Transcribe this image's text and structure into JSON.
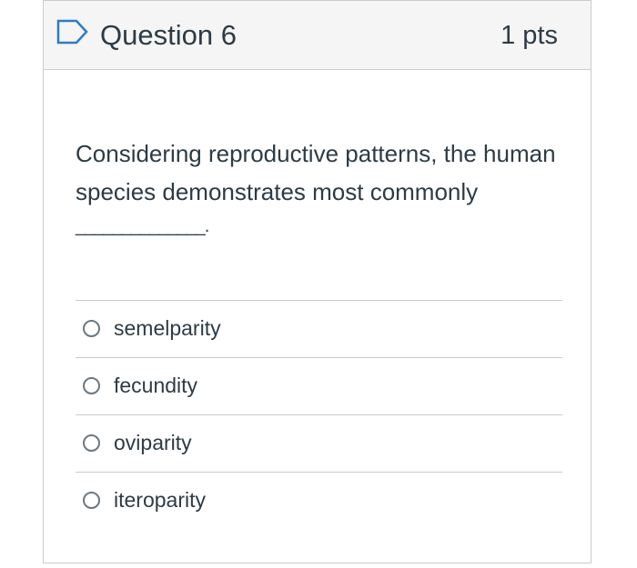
{
  "question": {
    "title": "Question 6",
    "points": "1 pts",
    "text": "Considering reproductive patterns, the human species demonstrates most commonly",
    "blank": "______________."
  },
  "answers": [
    {
      "label": "semelparity"
    },
    {
      "label": "fecundity"
    },
    {
      "label": "oviparity"
    },
    {
      "label": "iteroparity"
    }
  ],
  "colors": {
    "flag": "#2d7bc6",
    "header_bg": "#f5f5f5",
    "border": "#c7cdd1",
    "text": "#2d3b45"
  },
  "icons": {
    "flag": "flag-question-icon",
    "radio": "radio-button-icon"
  }
}
